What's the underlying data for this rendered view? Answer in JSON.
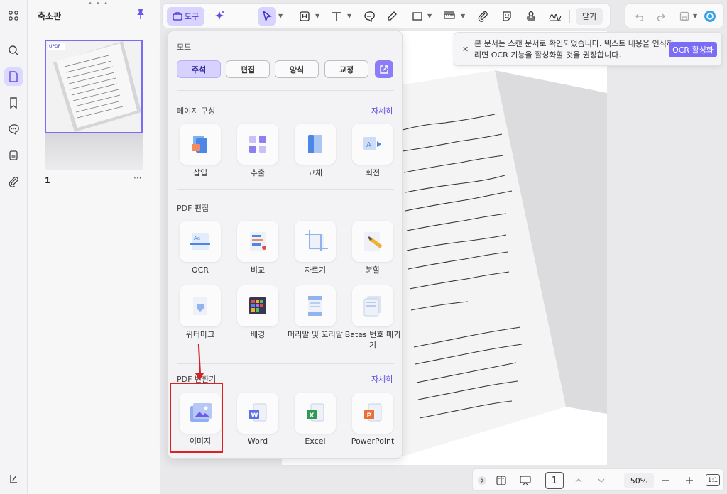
{
  "sidebar": {
    "title": "축소판",
    "page_number": "1",
    "more": "···"
  },
  "toolbar": {
    "tool_label": "도구",
    "close_label": "닫기"
  },
  "notice": {
    "message": "본 문서는 스캔 문서로 확인되었습니다. 텍스트 내용을 인식하려면 OCR 기능을 활성화할 것을 권장합니다.",
    "button": "OCR 활성화"
  },
  "panel": {
    "mode_title": "모드",
    "modes": [
      "주석",
      "편집",
      "양식",
      "교정"
    ],
    "active_mode": "주석",
    "sections": [
      {
        "title": "페이지 구성",
        "link": "자세히",
        "items": [
          "삽입",
          "추출",
          "교체",
          "회전"
        ]
      },
      {
        "title": "PDF 편집",
        "link": "",
        "items": [
          "OCR",
          "비교",
          "자르기",
          "분할",
          "워터마크",
          "배경",
          "머리말 및 꼬리말",
          "Bates 번호 매기기"
        ]
      },
      {
        "title": "PDF 변환기",
        "link": "자세히",
        "items": [
          "이미지",
          "Word",
          "Excel",
          "PowerPoint"
        ]
      }
    ]
  },
  "bottom": {
    "page": "1",
    "zoom": "50%",
    "fit": "1:1"
  },
  "colors": {
    "accent": "#7b6cf6",
    "highlight": "#e02020"
  }
}
